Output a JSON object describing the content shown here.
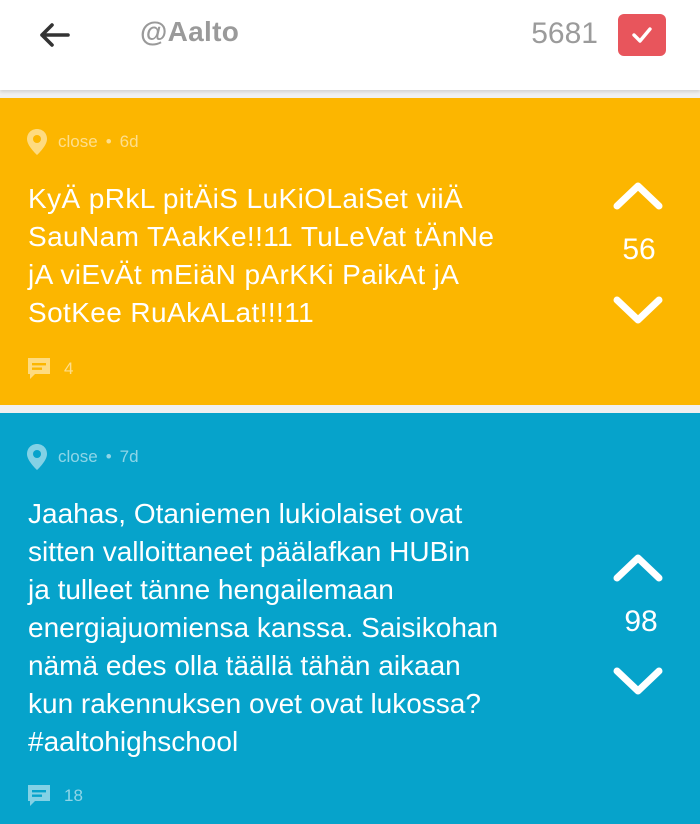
{
  "header": {
    "channel": "@Aalto",
    "karma": "5681"
  },
  "posts": [
    {
      "location": "close",
      "age": "6d",
      "text": "KyÄ pRkL pitÄiS LuKiOLaiSet viiÄ\nSauNam TAakKe!!11 TuLeVat tÄnNe\njA viEvÄt mEiäN pArKKi PaikAt jA\nSotKee RuAkALat!!!11",
      "votes": "56",
      "comments": "4",
      "color": "#fcb600"
    },
    {
      "location": "close",
      "age": "7d",
      "text": "Jaahas, Otaniemen lukiolaiset ovat\nsitten valloittaneet päälafkan HUBin\nja tulleet tänne hengailemaan\nenergiajuomiensa kanssa. Saisikohan\nnämä edes olla täällä tähän aikaan\nkun rakennuksen ovet ovat lukossa?\n#aaltohighschool",
      "votes": "98",
      "comments": "18",
      "color": "#06a3cb"
    }
  ],
  "icons": {
    "back": "arrow-left-icon",
    "karma": "check-icon",
    "location": "location-pin-icon",
    "up": "chevron-up-icon",
    "down": "chevron-down-icon",
    "comment": "speech-bubble-icon"
  }
}
